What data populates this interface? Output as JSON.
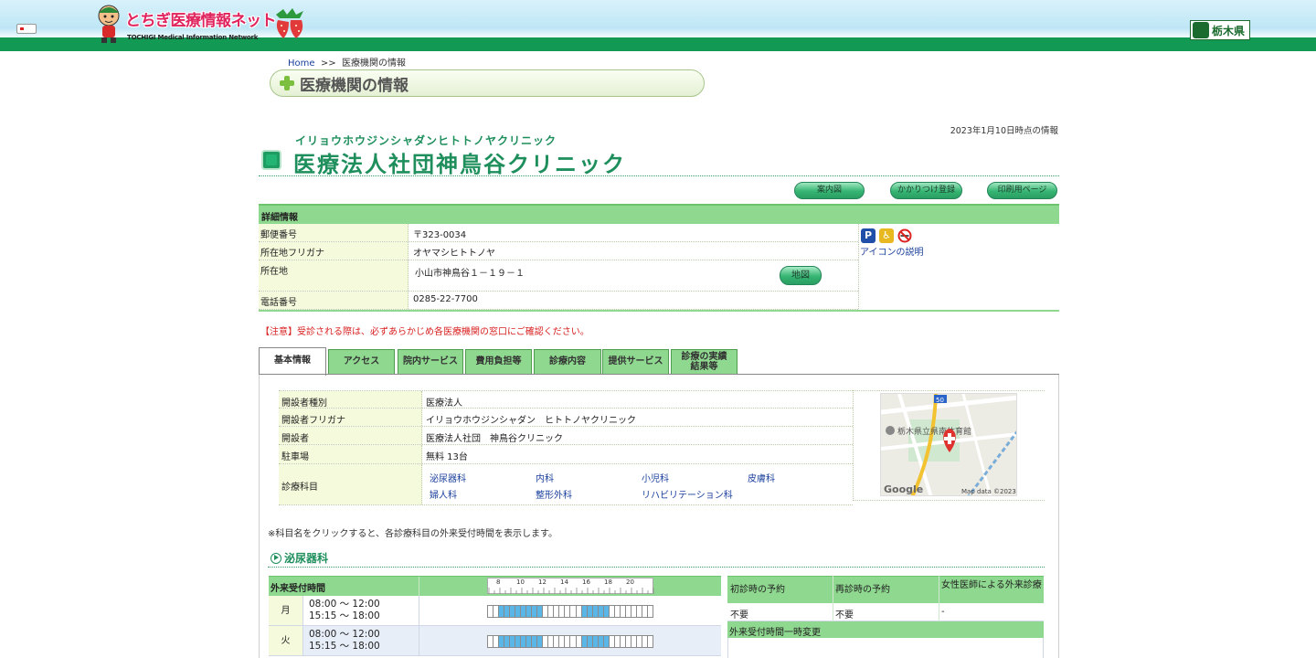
{
  "header": {
    "logo_main": "とちぎ医療情報ネット",
    "logo_sub": "TOCHIGI Medical Information Network",
    "pref_name": "栃木県"
  },
  "breadcrumb": {
    "home": "Home",
    "separator": ">>",
    "current": "医療機関の情報"
  },
  "section_title": "医療機関の情報",
  "as_of": "2023年1月10日時点の情報",
  "clinic": {
    "kana": "イリョウホウジンシャダンヒトトノヤクリニック",
    "name": "医療法人社団神鳥谷クリニック"
  },
  "buttons": {
    "guide_map": "案内図",
    "family_doctor": "かかりつけ登録",
    "print": "印刷用ページ",
    "map": "地図"
  },
  "detail": {
    "heading": "詳細情報",
    "rows": [
      {
        "label": "郵便番号",
        "value": "〒323-0034"
      },
      {
        "label": "所在地フリガナ",
        "value": "オヤマシヒトトノヤ"
      },
      {
        "label": "所在地",
        "value": "小山市神鳥谷１－１９－１"
      },
      {
        "label": "電話番号",
        "value": "0285-22-7700"
      }
    ],
    "icon_legend": "アイコンの説明",
    "icons": [
      "parking-icon",
      "barrier-free-icon",
      "no-smoking-icon"
    ]
  },
  "notice": "【注意】受診される際は、必ずあらかじめ各医療機関の窓口にご確認ください。",
  "tabs": [
    {
      "label": "基本情報",
      "active": true
    },
    {
      "label": "アクセス"
    },
    {
      "label": "院内サービス"
    },
    {
      "label": "費用負担等"
    },
    {
      "label": "診療内容"
    },
    {
      "label": "提供サービス"
    },
    {
      "label_line1": "診療の実績",
      "label_line2": "結果等"
    }
  ],
  "basic": {
    "rows": [
      {
        "label": "開設者種別",
        "value": "医療法人"
      },
      {
        "label": "開設者フリガナ",
        "value": "イリョウホウジンシャダン　ヒトトノヤクリニック"
      },
      {
        "label": "開設者",
        "value": "医療法人社団　神鳥谷クリニック"
      },
      {
        "label": "駐車場",
        "value": "無料 13台"
      },
      {
        "label": "診療科目"
      }
    ],
    "departments": [
      "泌尿器科",
      "内科",
      "小児科",
      "皮膚科",
      "婦人科",
      "整形外科",
      "リハビリテーション科"
    ],
    "map": {
      "place_label": "栃木県立県南体育館",
      "route_number": "50",
      "brand": "Google",
      "attribution": "Map data ©2023"
    }
  },
  "note": "※科目名をクリックすると、各診療科目の外来受付時間を表示します。",
  "department_section": {
    "title": "泌尿器科",
    "hours_heading": "外来受付時間",
    "scale_ticks": [
      "8",
      "10",
      "12",
      "14",
      "16",
      "18",
      "20"
    ],
    "hours": [
      {
        "day": "月",
        "line1": "08:00 ～ 12:00",
        "line2": "15:15 ～ 18:00"
      },
      {
        "day": "火",
        "line1": "08:00 ～ 12:00",
        "line2": "15:15 ～ 18:00"
      }
    ],
    "reservation": {
      "col1": "初診時の予約",
      "col2": "再診時の予約",
      "col3": "女性医師による外来診療",
      "val1": "不要",
      "val2": "不要",
      "val3": "-",
      "temp_change": "外来受付時間一時変更"
    }
  },
  "colors": {
    "brand_green": "#1e8f5c",
    "header_green": "#129a55",
    "table_green": "#8fd88f",
    "notice_red": "#d92020",
    "link_blue": "#1a3f9c"
  }
}
